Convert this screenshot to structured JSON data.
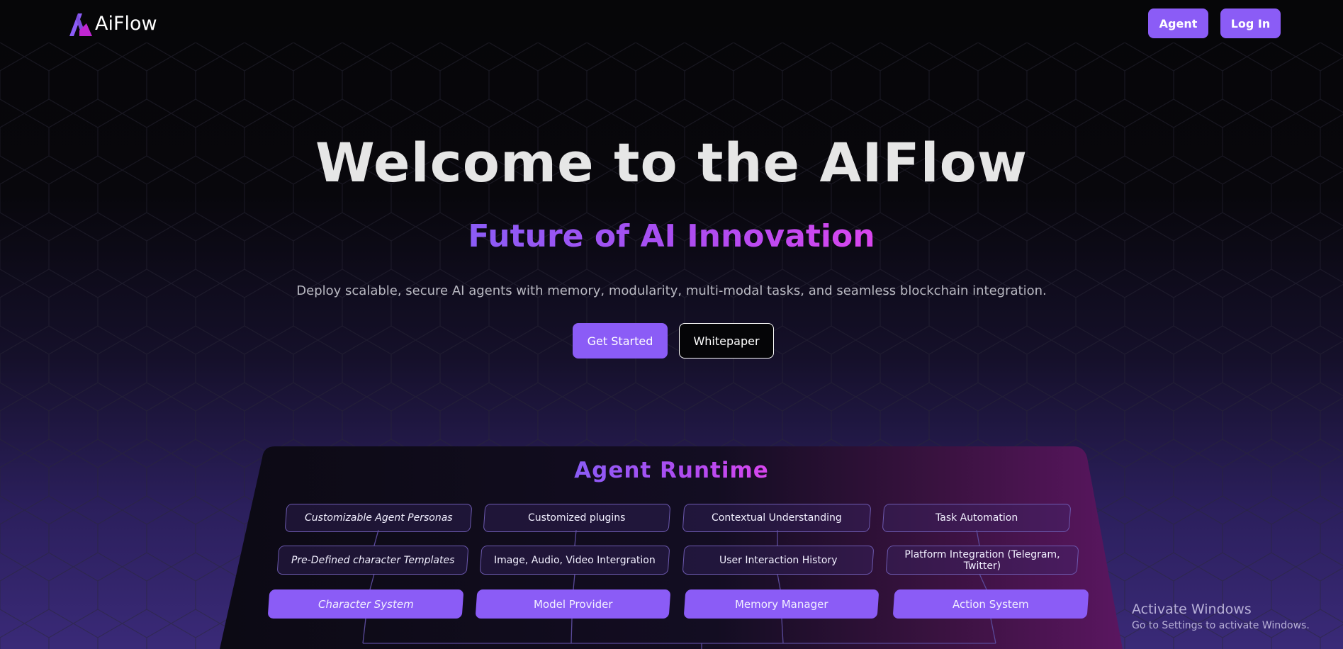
{
  "nav": {
    "logo_text": "AiFlow",
    "agent_label": "Agent",
    "login_label": "Log In"
  },
  "hero": {
    "title": "Welcome to the AIFlow",
    "subtitle": "Future of AI Innovation",
    "description": "Deploy scalable, secure AI agents with memory, modularity, multi-modal tasks, and seamless blockchain integration.",
    "get_started_label": "Get Started",
    "whitepaper_label": "Whitepaper"
  },
  "runtime": {
    "title": "Agent Runtime",
    "row1": [
      "Customizable Agent Personas",
      "Customized plugins",
      "Contextual Understanding",
      "Task Automation"
    ],
    "row2": [
      "Pre-Defined character Templates",
      "Image, Audio, Video Intergration",
      "User Interaction History",
      "Platform Integration (Telegram, Twitter)"
    ],
    "core": [
      "Character System",
      "Model Provider",
      "Memory Manager",
      "Action System"
    ]
  },
  "watermark": {
    "line1": "Activate Windows",
    "line2": "Go to Settings to activate Windows."
  },
  "colors": {
    "accent": "#8b5cf6",
    "accent_pink": "#d946ef",
    "background": "#060608"
  }
}
